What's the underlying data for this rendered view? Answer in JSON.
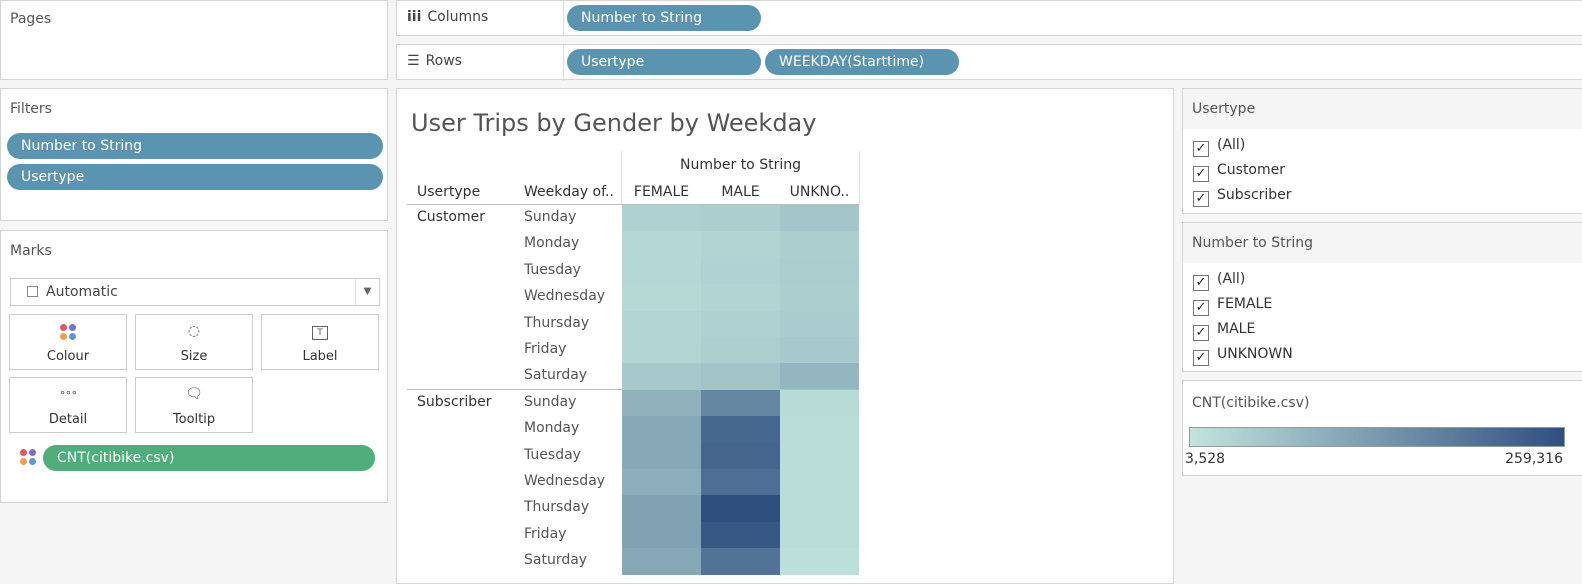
{
  "pages": {
    "title": "Pages"
  },
  "columns_shelf": {
    "label": "Columns",
    "pills": [
      "Number to String"
    ]
  },
  "rows_shelf": {
    "label": "Rows",
    "pills": [
      "Usertype",
      "WEEKDAY(Starttime)"
    ]
  },
  "filters": {
    "title": "Filters",
    "pills": [
      "Number to String",
      "Usertype"
    ]
  },
  "marks": {
    "title": "Marks",
    "type_select": "Automatic",
    "buttons": [
      {
        "label": "Colour",
        "icon": "colour-dots-icon"
      },
      {
        "label": "Size",
        "icon": "size-icon"
      },
      {
        "label": "Label",
        "icon": "label-icon"
      },
      {
        "label": "Detail",
        "icon": "detail-icon"
      },
      {
        "label": "Tooltip",
        "icon": "tooltip-icon"
      }
    ],
    "field_pill": "CNT(citibike.csv)"
  },
  "viz": {
    "title": "User Trips by Gender by Weekday",
    "column_header_group": "Number to String",
    "header_usertype": "Usertype",
    "header_weekday": "Weekday of..",
    "gender_columns": [
      "FEMALE",
      "MALE",
      "UNKNO.."
    ],
    "groups": [
      {
        "usertype": "Customer",
        "days": [
          "Sunday",
          "Monday",
          "Tuesday",
          "Wednesday",
          "Thursday",
          "Friday",
          "Saturday"
        ]
      },
      {
        "usertype": "Subscriber",
        "days": [
          "Sunday",
          "Monday",
          "Tuesday",
          "Wednesday",
          "Thursday",
          "Friday",
          "Saturday"
        ]
      }
    ]
  },
  "chart_data": {
    "type": "heatmap",
    "title": "User Trips by Gender by Weekday",
    "x_categories": [
      "FEMALE",
      "MALE",
      "UNKNO.."
    ],
    "y_groups": [
      "Customer",
      "Subscriber"
    ],
    "y_categories": [
      "Sunday",
      "Monday",
      "Tuesday",
      "Wednesday",
      "Thursday",
      "Friday",
      "Saturday"
    ],
    "color_range": [
      3528,
      259316
    ],
    "color_low": "#c2e4dd",
    "color_high": "#2f4f7f",
    "values": [
      [
        12000,
        14000,
        22000
      ],
      [
        8000,
        10000,
        14000
      ],
      [
        8000,
        11000,
        15000
      ],
      [
        7000,
        10000,
        14000
      ],
      [
        9000,
        12000,
        16000
      ],
      [
        9000,
        13000,
        18000
      ],
      [
        18000,
        24000,
        40000
      ],
      [
        45000,
        120000,
        6000
      ],
      [
        60000,
        195000,
        5000
      ],
      [
        60000,
        200000,
        5000
      ],
      [
        50000,
        175000,
        5000
      ],
      [
        70000,
        259316,
        5000
      ],
      [
        70000,
        235000,
        5000
      ],
      [
        62000,
        165000,
        4500
      ]
    ]
  },
  "legend_usertype": {
    "title": "Usertype",
    "items": [
      "(All)",
      "Customer",
      "Subscriber"
    ]
  },
  "legend_gender": {
    "title": "Number to String",
    "items": [
      "(All)",
      "FEMALE",
      "MALE",
      "UNKNOWN"
    ]
  },
  "legend_color": {
    "title": "CNT(citibike.csv)",
    "min_label": "3,528",
    "max_label": "259,316"
  }
}
